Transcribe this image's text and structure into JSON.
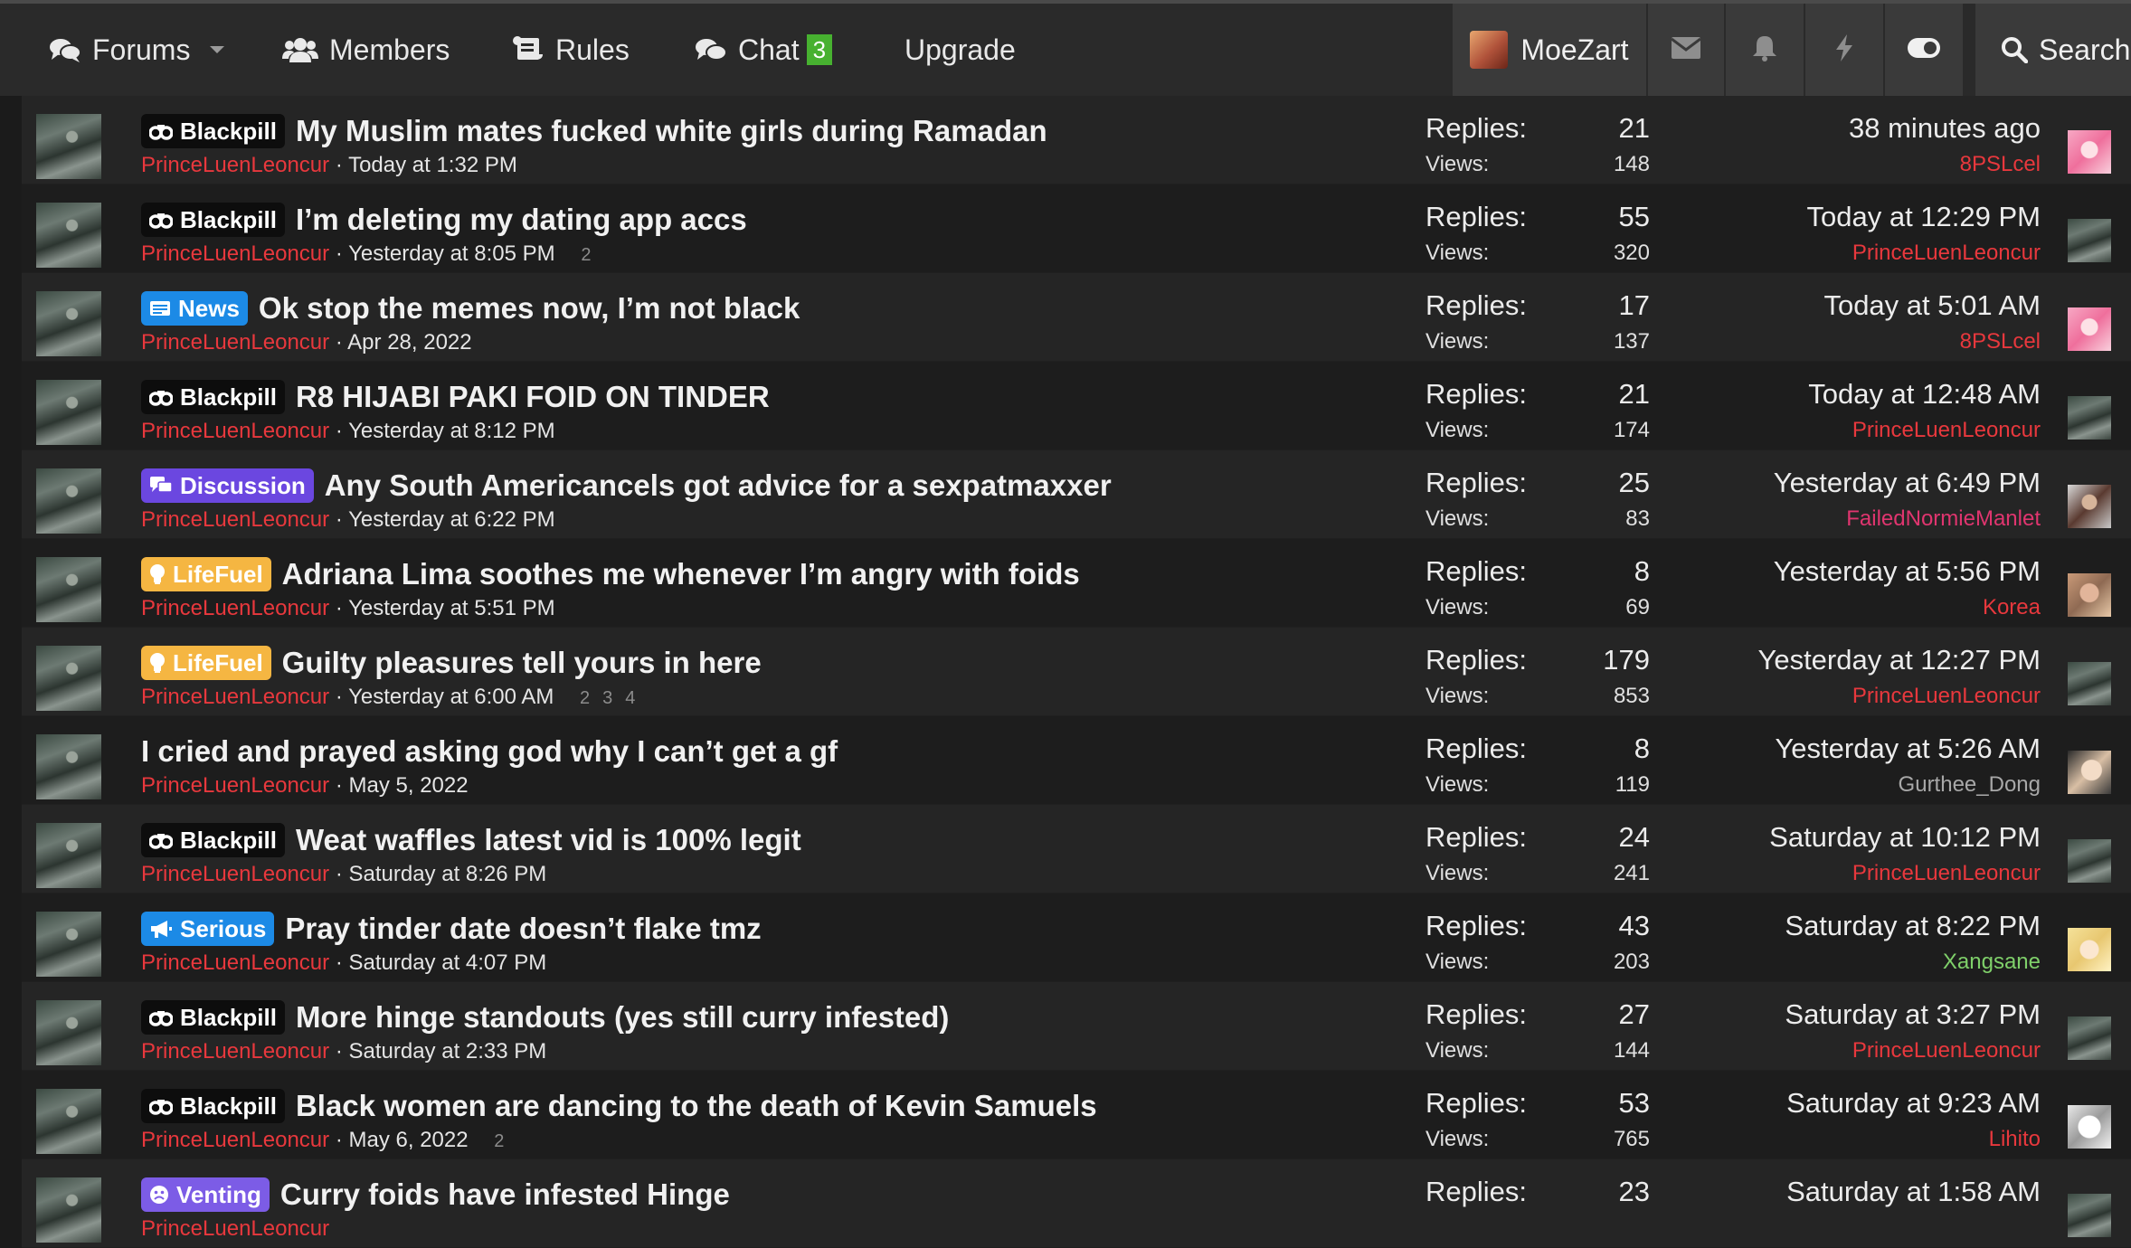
{
  "nav": {
    "forums": "Forums",
    "members": "Members",
    "rules": "Rules",
    "chat": "Chat",
    "chat_badge": "3",
    "upgrade": "Upgrade",
    "username": "MoeZart",
    "search": "Search"
  },
  "threads": [
    {
      "prefix": "Blackpill",
      "prefix_color": "#0d0d0d",
      "prefix_icon": "gamepad-icon",
      "title": "My Muslim mates fucked white girls during Ramadan",
      "author": "PrinceLuenLeoncur",
      "date": "Today at 1:32 PM",
      "pages": [],
      "replies_label": "Replies:",
      "views_label": "Views:",
      "replies": "21",
      "views": "148",
      "last_date": "38 minutes ago",
      "last_user": "8PSLcel",
      "last_user_color": "#e8383d",
      "last_avatar": "pink"
    },
    {
      "prefix": "Blackpill",
      "prefix_color": "#0d0d0d",
      "prefix_icon": "gamepad-icon",
      "title": "I’m deleting my dating app accs",
      "author": "PrinceLuenLeoncur",
      "date": "Yesterday at 8:05 PM",
      "pages": [
        "2"
      ],
      "replies_label": "Replies:",
      "views_label": "Views:",
      "replies": "55",
      "views": "320",
      "last_date": "Today at 12:29 PM",
      "last_user": "PrinceLuenLeoncur",
      "last_user_color": "#e8383d",
      "last_avatar": "knight"
    },
    {
      "prefix": "News",
      "prefix_color": "#1c8ae6",
      "prefix_icon": "newspaper-icon",
      "title": "Ok stop the memes now, I’m not black",
      "author": "PrinceLuenLeoncur",
      "date": "Apr 28, 2022",
      "pages": [],
      "replies_label": "Replies:",
      "views_label": "Views:",
      "replies": "17",
      "views": "137",
      "last_date": "Today at 5:01 AM",
      "last_user": "8PSLcel",
      "last_user_color": "#e8383d",
      "last_avatar": "pink"
    },
    {
      "prefix": "Blackpill",
      "prefix_color": "#0d0d0d",
      "prefix_icon": "gamepad-icon",
      "title": "R8 HIJABI PAKI FOID ON TINDER",
      "author": "PrinceLuenLeoncur",
      "date": "Yesterday at 8:12 PM",
      "pages": [],
      "replies_label": "Replies:",
      "views_label": "Views:",
      "replies": "21",
      "views": "174",
      "last_date": "Today at 12:48 AM",
      "last_user": "PrinceLuenLeoncur",
      "last_user_color": "#e8383d",
      "last_avatar": "knight"
    },
    {
      "prefix": "Discussion",
      "prefix_color": "#6b47e0",
      "prefix_icon": "chat-bubbles-icon",
      "title": "Any South Americancels got advice for a sexpatmaxxer",
      "author": "PrinceLuenLeoncur",
      "date": "Yesterday at 6:22 PM",
      "pages": [],
      "replies_label": "Replies:",
      "views_label": "Views:",
      "replies": "25",
      "views": "83",
      "last_date": "Yesterday at 6:49 PM",
      "last_user": "FailedNormieManlet",
      "last_user_color": "#e0356f",
      "last_avatar": "portrait"
    },
    {
      "prefix": "LifeFuel",
      "prefix_color": "#f5b642",
      "prefix_icon": "lightbulb-icon",
      "title": "Adriana Lima soothes me whenever I’m angry with foids",
      "author": "PrinceLuenLeoncur",
      "date": "Yesterday at 5:51 PM",
      "pages": [],
      "replies_label": "Replies:",
      "views_label": "Views:",
      "replies": "8",
      "views": "69",
      "last_date": "Yesterday at 5:56 PM",
      "last_user": "Korea",
      "last_user_color": "#e8383d",
      "last_avatar": "blonde"
    },
    {
      "prefix": "LifeFuel",
      "prefix_color": "#f5b642",
      "prefix_icon": "lightbulb-icon",
      "title": "Guilty pleasures tell yours in here",
      "author": "PrinceLuenLeoncur",
      "date": "Yesterday at 6:00 AM",
      "pages": [
        "2",
        "3",
        "4"
      ],
      "replies_label": "Replies:",
      "views_label": "Views:",
      "replies": "179",
      "views": "853",
      "last_date": "Yesterday at 12:27 PM",
      "last_user": "PrinceLuenLeoncur",
      "last_user_color": "#e8383d",
      "last_avatar": "knight"
    },
    {
      "prefix": "",
      "prefix_color": "",
      "prefix_icon": "",
      "title": "I cried and prayed asking god why I can’t get a gf",
      "author": "PrinceLuenLeoncur",
      "date": "May 5, 2022",
      "pages": [],
      "replies_label": "Replies:",
      "views_label": "Views:",
      "replies": "8",
      "views": "119",
      "last_date": "Yesterday at 5:26 AM",
      "last_user": "Gurthee_Dong",
      "last_user_color": "#a8a8a8",
      "last_avatar": "pale"
    },
    {
      "prefix": "Blackpill",
      "prefix_color": "#0d0d0d",
      "prefix_icon": "gamepad-icon",
      "title": "Weat waffles latest vid is 100% legit",
      "author": "PrinceLuenLeoncur",
      "date": "Saturday at 8:26 PM",
      "pages": [],
      "replies_label": "Replies:",
      "views_label": "Views:",
      "replies": "24",
      "views": "241",
      "last_date": "Saturday at 10:12 PM",
      "last_user": "PrinceLuenLeoncur",
      "last_user_color": "#e8383d",
      "last_avatar": "knight"
    },
    {
      "prefix": "Serious",
      "prefix_color": "#1c8ae6",
      "prefix_icon": "megaphone-icon",
      "title": "Pray tinder date doesn’t flake tmz",
      "author": "PrinceLuenLeoncur",
      "date": "Saturday at 4:07 PM",
      "pages": [],
      "replies_label": "Replies:",
      "views_label": "Views:",
      "replies": "43",
      "views": "203",
      "last_date": "Saturday at 8:22 PM",
      "last_user": "Xangsane",
      "last_user_color": "#7fd06a",
      "last_avatar": "anime"
    },
    {
      "prefix": "Blackpill",
      "prefix_color": "#0d0d0d",
      "prefix_icon": "gamepad-icon",
      "title": "More hinge standouts (yes still curry infested)",
      "author": "PrinceLuenLeoncur",
      "date": "Saturday at 2:33 PM",
      "pages": [],
      "replies_label": "Replies:",
      "views_label": "Views:",
      "replies": "27",
      "views": "144",
      "last_date": "Saturday at 3:27 PM",
      "last_user": "PrinceLuenLeoncur",
      "last_user_color": "#e8383d",
      "last_avatar": "knight"
    },
    {
      "prefix": "Blackpill",
      "prefix_color": "#0d0d0d",
      "prefix_icon": "gamepad-icon",
      "title": "Black women are dancing to the death of Kevin Samuels",
      "author": "PrinceLuenLeoncur",
      "date": "May 6, 2022",
      "pages": [
        "2"
      ],
      "replies_label": "Replies:",
      "views_label": "Views:",
      "replies": "53",
      "views": "765",
      "last_date": "Saturday at 9:23 AM",
      "last_user": "Lihito",
      "last_user_color": "#e8383d",
      "last_avatar": "sketch"
    },
    {
      "prefix": "Venting",
      "prefix_color": "#7c5ce6",
      "prefix_icon": "sad-face-icon",
      "title": "Curry foids have infested Hinge",
      "author": "PrinceLuenLeoncur",
      "date": "",
      "pages": [],
      "replies_label": "Replies:",
      "views_label": "",
      "replies": "23",
      "views": "",
      "last_date": "Saturday at 1:58 AM",
      "last_user": "",
      "last_user_color": "#e8383d",
      "last_avatar": "knight"
    }
  ]
}
